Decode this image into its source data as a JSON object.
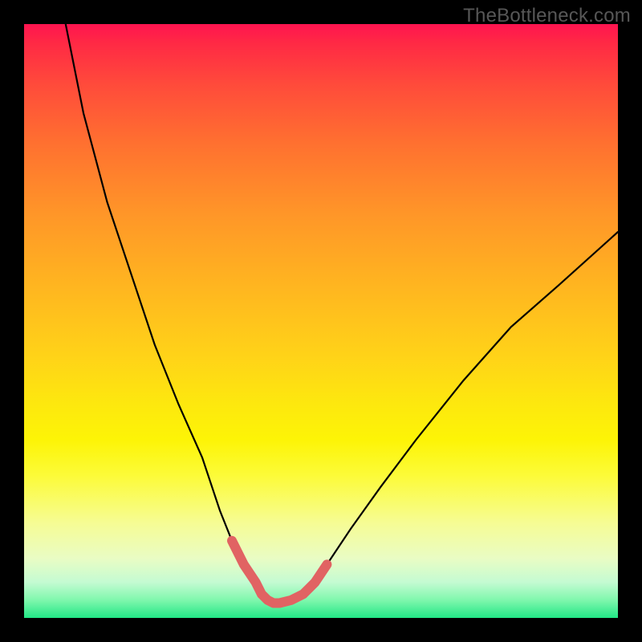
{
  "watermark": "TheBottleneck.com",
  "chart_data": {
    "type": "line",
    "title": "",
    "xlabel": "",
    "ylabel": "",
    "xlim": [
      0,
      100
    ],
    "ylim": [
      0,
      100
    ],
    "series": [
      {
        "name": "main-curve",
        "x": [
          7,
          10,
          14,
          18,
          22,
          26,
          30,
          33,
          35,
          37,
          39,
          40,
          41,
          42,
          43,
          45,
          47,
          49,
          51,
          55,
          60,
          66,
          74,
          82,
          90,
          100
        ],
        "y": [
          100,
          85,
          70,
          58,
          46,
          36,
          27,
          18,
          13,
          9,
          6,
          4,
          3,
          2.5,
          2.5,
          3,
          4,
          6,
          9,
          15,
          22,
          30,
          40,
          49,
          56,
          65
        ]
      },
      {
        "name": "bottom-highlight",
        "x": [
          35,
          37,
          39,
          40,
          41,
          42,
          43,
          45,
          47,
          49,
          51
        ],
        "y": [
          13,
          9,
          6,
          4,
          3,
          2.5,
          2.5,
          3,
          4,
          6,
          9
        ]
      }
    ],
    "gradient_stops": [
      {
        "pos": 0,
        "color": "#ff1450"
      },
      {
        "pos": 50,
        "color": "#ffd318"
      },
      {
        "pos": 75,
        "color": "#fcfb38"
      },
      {
        "pos": 100,
        "color": "#22e786"
      }
    ]
  }
}
